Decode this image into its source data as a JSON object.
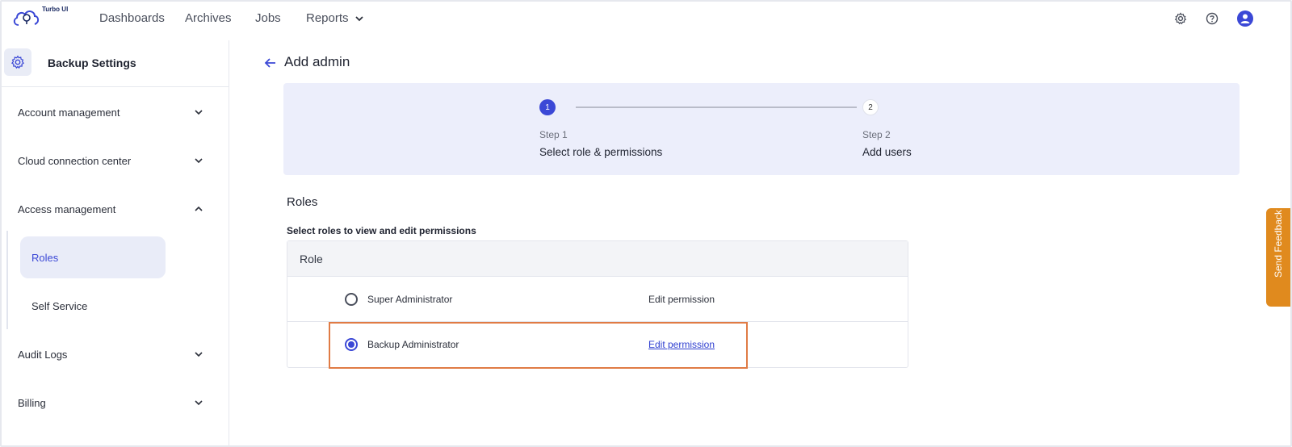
{
  "app": {
    "logo_text": "Turbo UI"
  },
  "nav": {
    "items": [
      {
        "label": "Dashboards"
      },
      {
        "label": "Archives"
      },
      {
        "label": "Jobs"
      },
      {
        "label": "Reports"
      }
    ],
    "icons": [
      "gear-icon",
      "help-icon",
      "user-avatar-icon"
    ]
  },
  "sidebar": {
    "title": "Backup Settings",
    "items": [
      {
        "label": "Account management",
        "expanded": false
      },
      {
        "label": "Cloud connection center",
        "expanded": false
      },
      {
        "label": "Access management",
        "expanded": true
      },
      {
        "label": "Audit Logs",
        "expanded": false
      },
      {
        "label": "Billing",
        "expanded": false
      }
    ],
    "sub_items": [
      {
        "label": "Roles",
        "active": true
      },
      {
        "label": "Self Service",
        "active": false
      }
    ]
  },
  "page": {
    "title": "Add admin"
  },
  "stepper": {
    "steps": [
      {
        "number": "1",
        "label": "Step 1",
        "name": "Select role & permissions",
        "active": true
      },
      {
        "number": "2",
        "label": "Step 2",
        "name": "Add users",
        "active": false
      }
    ]
  },
  "roles": {
    "title": "Roles",
    "description": "Select roles to view and edit permissions",
    "column_header": "Role",
    "rows": [
      {
        "name": "Super Administrator",
        "action": "Edit permission",
        "selected": false
      },
      {
        "name": "Backup Administrator",
        "action": "Edit permission",
        "selected": true
      }
    ]
  },
  "feedback": {
    "label": "Send Feedback"
  },
  "colors": {
    "accent": "#3b48d6",
    "highlight": "#e07b45",
    "feedback": "#e08a1e",
    "stepper_bg": "#eceefb"
  }
}
